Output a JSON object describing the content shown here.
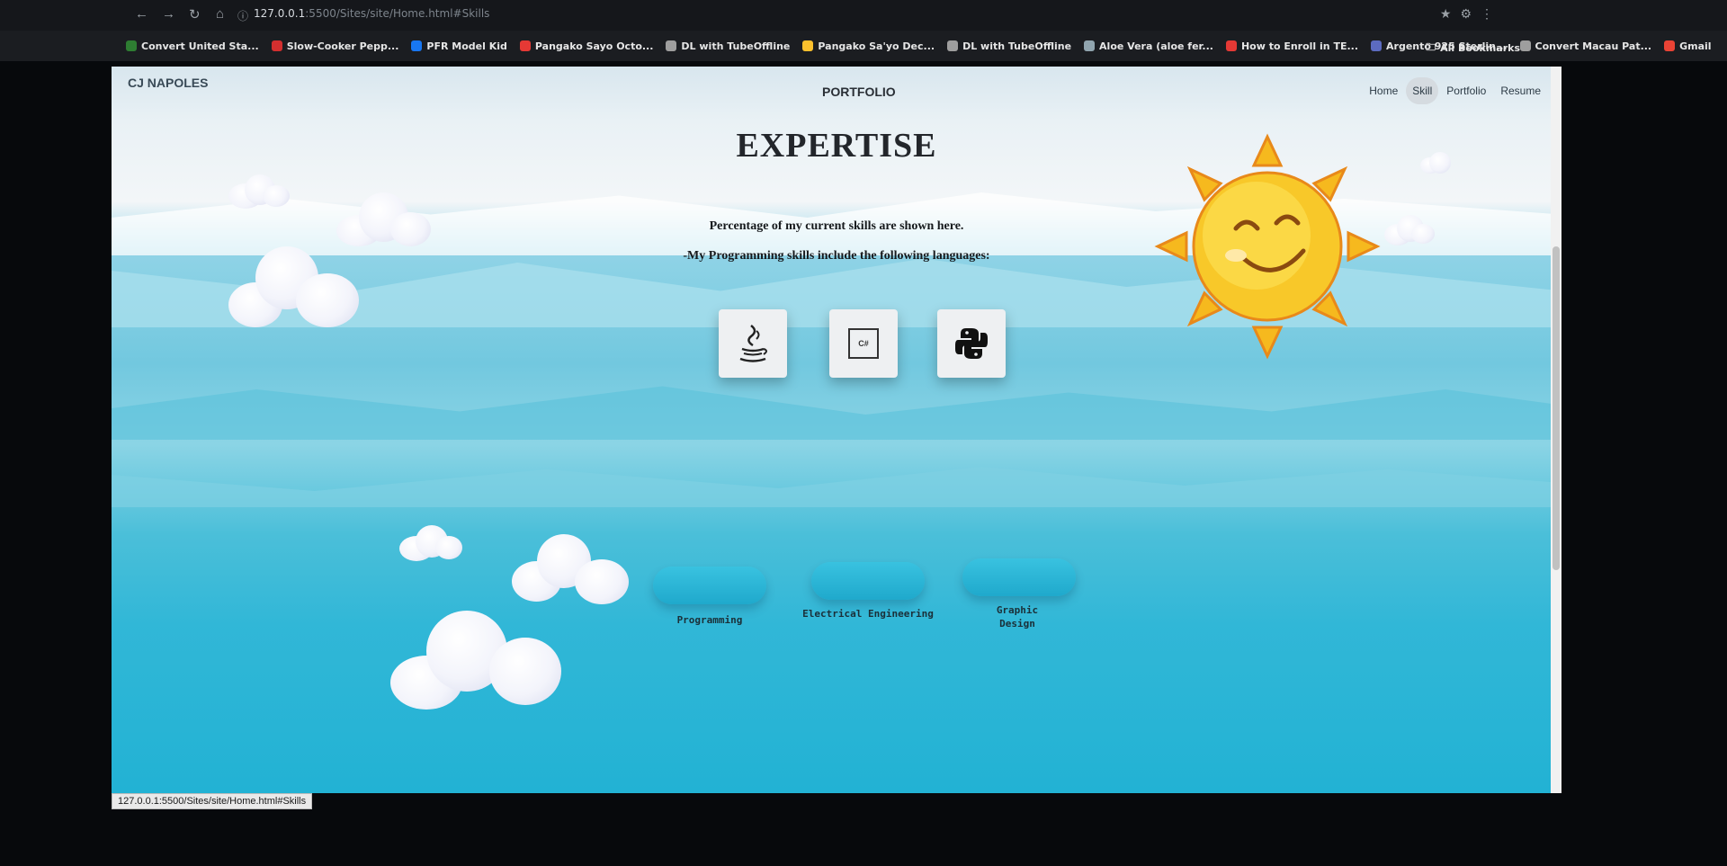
{
  "browser": {
    "url_host": "127.0.0.1",
    "url_path": ":5500/Sites/site/Home.html#Skills",
    "status_url": "127.0.0.1:5500/Sites/site/Home.html#Skills",
    "all_bookmarks": "All Bookmarks",
    "bookmarks": [
      {
        "label": "Convert United Sta...",
        "color": "#2e7d32"
      },
      {
        "label": "Slow-Cooker Pepp...",
        "color": "#d32f2f"
      },
      {
        "label": "PFR Model Kid",
        "color": "#1877f2"
      },
      {
        "label": "Pangako Sayo Octo...",
        "color": "#e53935"
      },
      {
        "label": "DL with TubeOffline",
        "color": "#9e9e9e"
      },
      {
        "label": "Pangako Sa'yo Dec...",
        "color": "#fbc02d"
      },
      {
        "label": "DL with TubeOffline",
        "color": "#9e9e9e"
      },
      {
        "label": "Aloe Vera (aloe fer...",
        "color": "#90a4ae"
      },
      {
        "label": "How to Enroll in TE...",
        "color": "#e53935"
      },
      {
        "label": "Argento 925 Sterlin...",
        "color": "#5c6bc0"
      },
      {
        "label": "Convert Macau Pat...",
        "color": "#9e9e9e"
      },
      {
        "label": "Gmail",
        "color": "#ea4335"
      }
    ]
  },
  "page": {
    "brand": "CJ NAPOLES",
    "title": "PORTFOLIO",
    "nav": [
      "Home",
      "Skill",
      "Portfolio",
      "Resume"
    ],
    "active_nav": "Skill",
    "heading": "EXPERTISE",
    "line1": "Percentage of my current skills are shown here.",
    "line2": "-My Programming skills include the following languages:",
    "languages": [
      "java-icon",
      "csharp-icon",
      "python-icon"
    ],
    "csharp_text": "C#",
    "skills": [
      {
        "label": "Programming"
      },
      {
        "label": "Electrical Engineering"
      },
      {
        "label": "Graphic Design"
      }
    ]
  }
}
